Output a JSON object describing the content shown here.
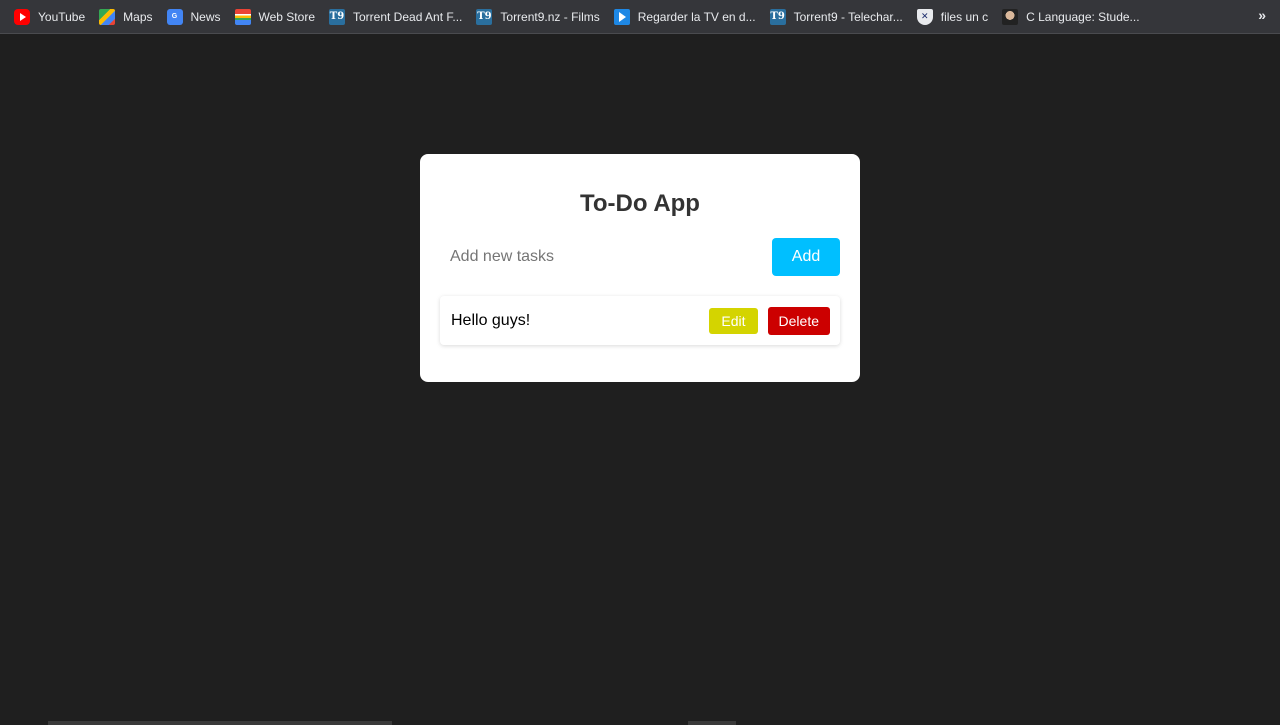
{
  "bookmarks": [
    {
      "label": "YouTube",
      "icon": "youtube-icon"
    },
    {
      "label": "Maps",
      "icon": "maps-icon"
    },
    {
      "label": "News",
      "icon": "news-icon"
    },
    {
      "label": "Web Store",
      "icon": "web-store-icon"
    },
    {
      "label": "Torrent Dead Ant F...",
      "icon": "t9-icon"
    },
    {
      "label": "Torrent9.nz - Films",
      "icon": "t9-icon"
    },
    {
      "label": "Regarder la TV en d...",
      "icon": "play-icon"
    },
    {
      "label": "Torrent9 - Telechar...",
      "icon": "t9-icon"
    },
    {
      "label": "files un c",
      "icon": "shield-icon"
    },
    {
      "label": "C Language: Stude...",
      "icon": "avatar-icon"
    }
  ],
  "bookmarks_more": "»",
  "app": {
    "title": "To-Do App",
    "input_placeholder": "Add new tasks",
    "input_value": "",
    "add_label": "Add",
    "tasks": [
      {
        "text": "Hello guys!",
        "edit_label": "Edit",
        "delete_label": "Delete"
      }
    ]
  },
  "colors": {
    "background": "#1f1f1f",
    "card": "#ffffff",
    "add_button": "#00bfff",
    "edit_button": "#d4d400",
    "delete_button": "#cc0000"
  }
}
